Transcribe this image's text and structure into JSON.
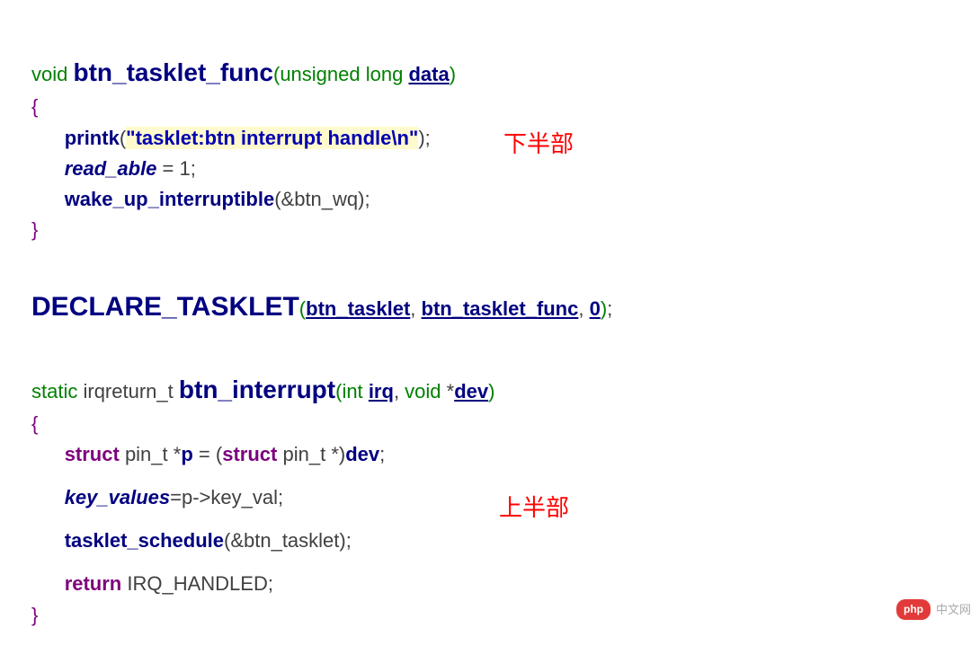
{
  "func1": {
    "ret_type": "void",
    "name": "btn_tasklet_func",
    "param_type": "unsigned long",
    "param_name": "data",
    "body": {
      "printk": "printk",
      "printk_arg": "\"tasklet:btn interrupt handle\\n\"",
      "read_able": "read_able",
      "eq": " = ",
      "one": "1",
      "wake": "wake_up_interruptible",
      "wake_arg": "btn_wq"
    }
  },
  "decl": {
    "macro": "DECLARE_TASKLET",
    "arg1": "btn_tasklet",
    "arg2": "btn_tasklet_func",
    "arg3": "0"
  },
  "func2": {
    "static": "static",
    "ret_type": "irqreturn_t",
    "name": "btn_interrupt",
    "p1_type": "int",
    "p1_name": "irq",
    "p2_type": "void",
    "p2_name": "dev",
    "body": {
      "struct": "struct",
      "pin_t": "pin_t",
      "star_p": "*",
      "p": "p",
      "cast_struct": "struct",
      "cast_pin_t": "pin_t",
      "dev": "dev",
      "key_values": "key_values",
      "p_arrow": "p->key_val",
      "tasklet_schedule": "tasklet_schedule",
      "ts_arg": "btn_tasklet",
      "return": "return",
      "irq_handled": "IRQ_HANDLED"
    }
  },
  "annotation1": "下半部",
  "annotation2": "上半部",
  "watermark": {
    "badge": "php",
    "text": "中文网"
  }
}
